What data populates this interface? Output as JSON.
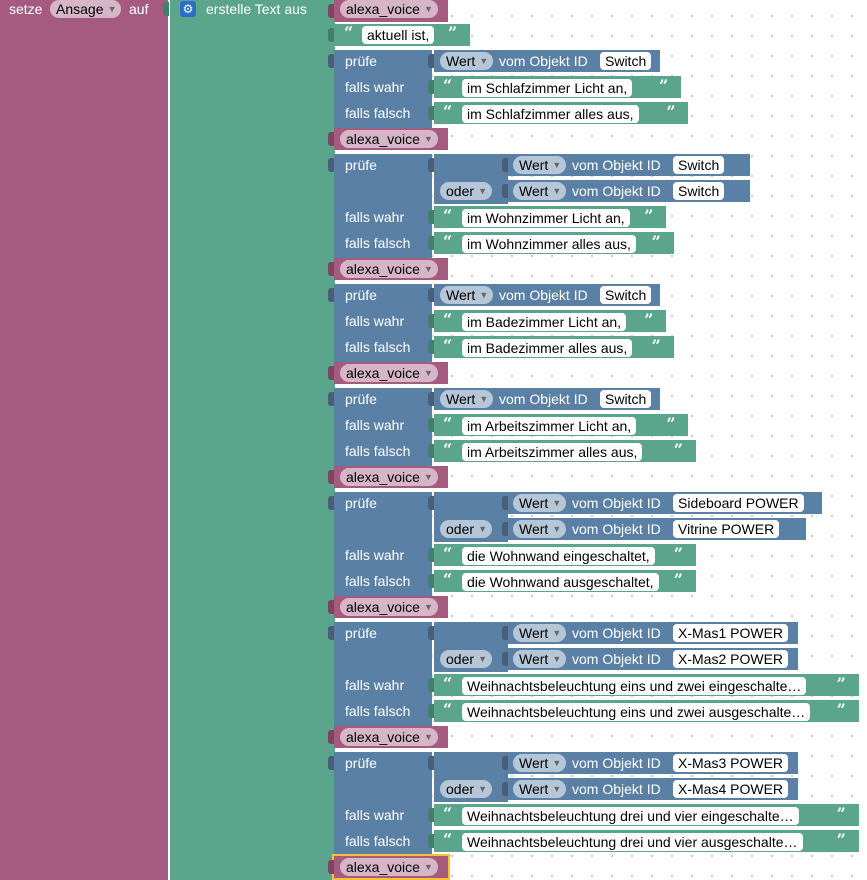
{
  "header": {
    "setze": "setze",
    "var": "Ansage",
    "auf": "auf",
    "create_text": "erstelle Text aus",
    "first_var": "alexa_voice",
    "first_text": "aktuell ist,"
  },
  "labels": {
    "check": "prüfe",
    "if_true": "falls wahr",
    "if_false": "falls falsch",
    "value": "Wert",
    "object_id": "vom Objekt ID",
    "or": "oder"
  },
  "sections": [
    {
      "var": "alexa_voice",
      "ids": [
        "Switch"
      ],
      "true_text": "im Schlafzimmer Licht an,",
      "false_text": "im Schlafzimmer alles aus,"
    },
    {
      "var": "alexa_voice",
      "ids": [
        "Switch",
        "Switch"
      ],
      "true_text": "im Wohnzimmer Licht an,",
      "false_text": "im Wohnzimmer alles aus,"
    },
    {
      "var": "alexa_voice",
      "ids": [
        "Switch"
      ],
      "true_text": "im Badezimmer Licht an,",
      "false_text": "im Badezimmer alles aus,"
    },
    {
      "var": "alexa_voice",
      "ids": [
        "Switch"
      ],
      "true_text": "im Arbeitszimmer Licht an,",
      "false_text": "im Arbeitszimmer alles aus,"
    },
    {
      "var": "alexa_voice",
      "ids": [
        "Sideboard POWER",
        "Vitrine POWER"
      ],
      "true_text": "die Wohnwand eingeschaltet,",
      "false_text": "die Wohnwand ausgeschaltet,"
    },
    {
      "var": "alexa_voice",
      "ids": [
        "X-Mas1 POWER",
        "X-Mas2 POWER"
      ],
      "true_text": "Weihnachtsbeleuchtung eins und zwei eingeschalte…",
      "false_text": "Weihnachtsbeleuchtung eins und zwei ausgeschalte…"
    },
    {
      "var": "alexa_voice",
      "ids": [
        "X-Mas3 POWER",
        "X-Mas4 POWER"
      ],
      "true_text": "Weihnachtsbeleuchtung drei und vier eingeschalte…",
      "false_text": "Weihnachtsbeleuchtung drei und vier ausgeschalte…"
    }
  ],
  "last_var": "alexa_voice",
  "colors": {
    "variable": "#a55b80",
    "text": "#5ba58c",
    "logic": "#5b80a5",
    "selected": "#fbc230"
  }
}
